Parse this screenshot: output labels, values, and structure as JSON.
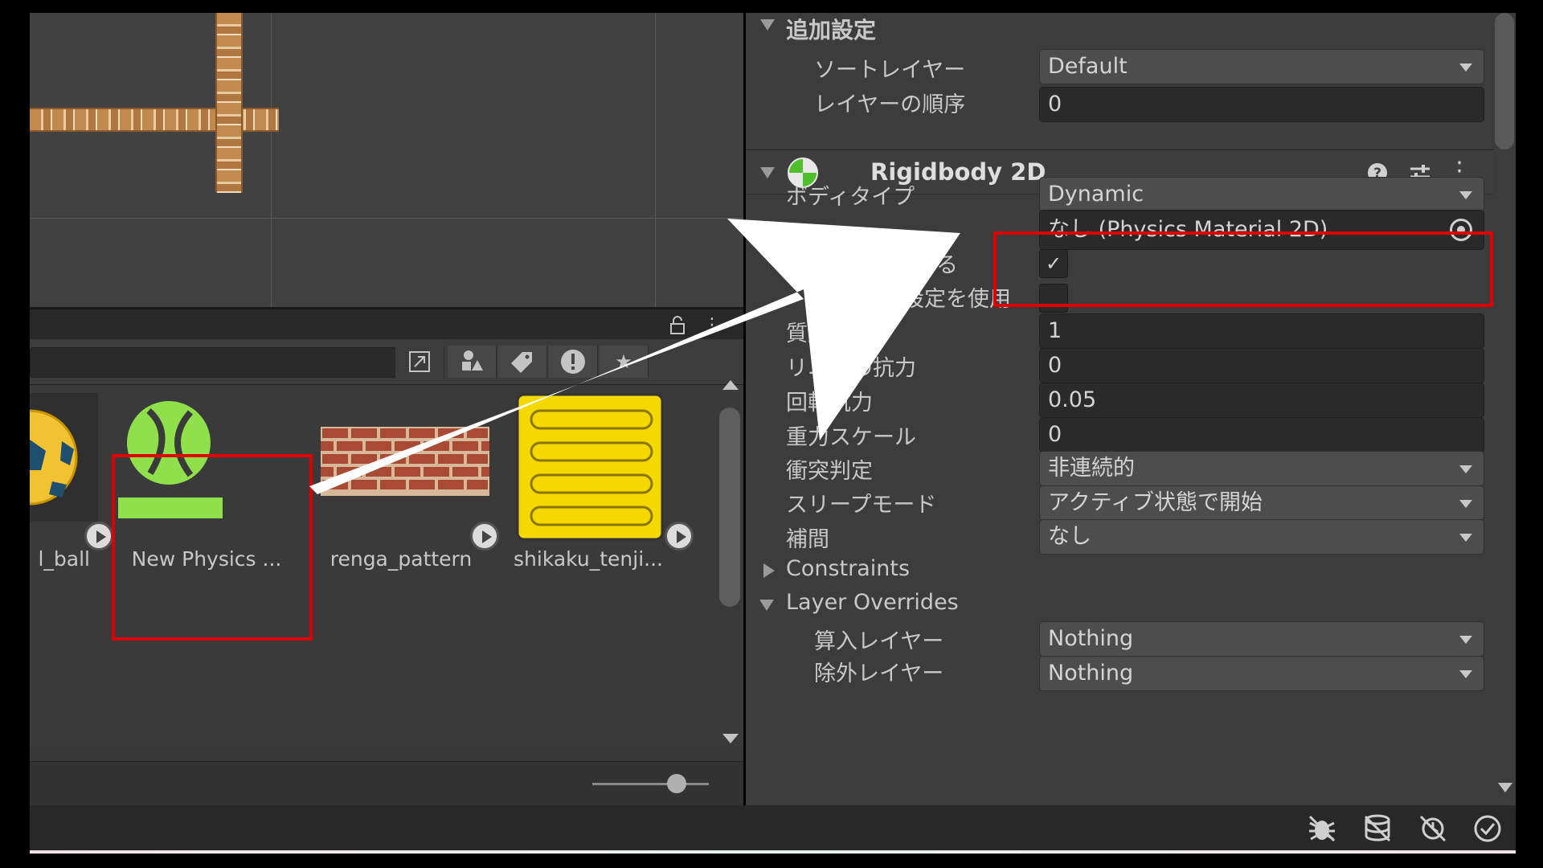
{
  "scene_view": {},
  "project_panel": {
    "lock_icon": "lock-icon",
    "menu_icon": "kebab-menu-icon",
    "toolbar_icons": [
      "open-window-icon",
      "type-filter-icon",
      "label-filter-icon",
      "warning-filter-icon",
      "favorite-star-icon"
    ],
    "assets": [
      {
        "label": "l_ball",
        "icon": "soccer-ball-icon"
      },
      {
        "label": "New Physics ...",
        "icon": "physics-material-icon"
      },
      {
        "label": "renga_pattern",
        "icon": "brick-texture-icon"
      },
      {
        "label": "shikaku_tenji...",
        "icon": "tactile-tile-icon"
      }
    ],
    "zoom_slider_value": 0.6
  },
  "inspector": {
    "additional_settings": {
      "header": "追加設定",
      "sorting_layer_label": "ソートレイヤー",
      "sorting_layer_value": "Default",
      "order_in_layer_label": "レイヤーの順序",
      "order_in_layer_value": "0"
    },
    "rigidbody": {
      "title": "Rigidbody 2D",
      "body_type_label": "ボディタイプ",
      "body_type_value": "Dynamic",
      "material_value": "なし (Physics Material 2D)",
      "simulated_label_fragment": "する",
      "simulated_checked": true,
      "auto_mass_label_fragment": "設定を使用",
      "auto_mass_checked": false,
      "mass_label_fragment": "質量",
      "mass_value": "1",
      "linear_drag_label": "リニアの抗力",
      "linear_drag_value": "0",
      "angular_drag_label": "回転抗力",
      "angular_drag_value": "0.05",
      "gravity_scale_label": "重力スケール",
      "gravity_scale_value": "0",
      "collision_detection_label": "衝突判定",
      "collision_detection_value": "非連続的",
      "sleeping_mode_label": "スリープモード",
      "sleeping_mode_value": "アクティブ状態で開始",
      "interpolate_label": "補間",
      "interpolate_value": "なし",
      "constraints_label": "Constraints",
      "layer_overrides_label": "Layer Overrides",
      "include_layers_label": "算入レイヤー",
      "include_layers_value": "Nothing",
      "exclude_layers_label": "除外レイヤー",
      "exclude_layers_value": "Nothing"
    }
  },
  "status_bar": {
    "icons": [
      "debug-icon",
      "cache-server-icon",
      "auto-refresh-icon",
      "status-ok-icon"
    ]
  },
  "colors": {
    "highlight": "#e00000",
    "arrow": "#ffffff",
    "physics_material_green": "#8fe04a",
    "tile_yellow": "#f5d800"
  }
}
